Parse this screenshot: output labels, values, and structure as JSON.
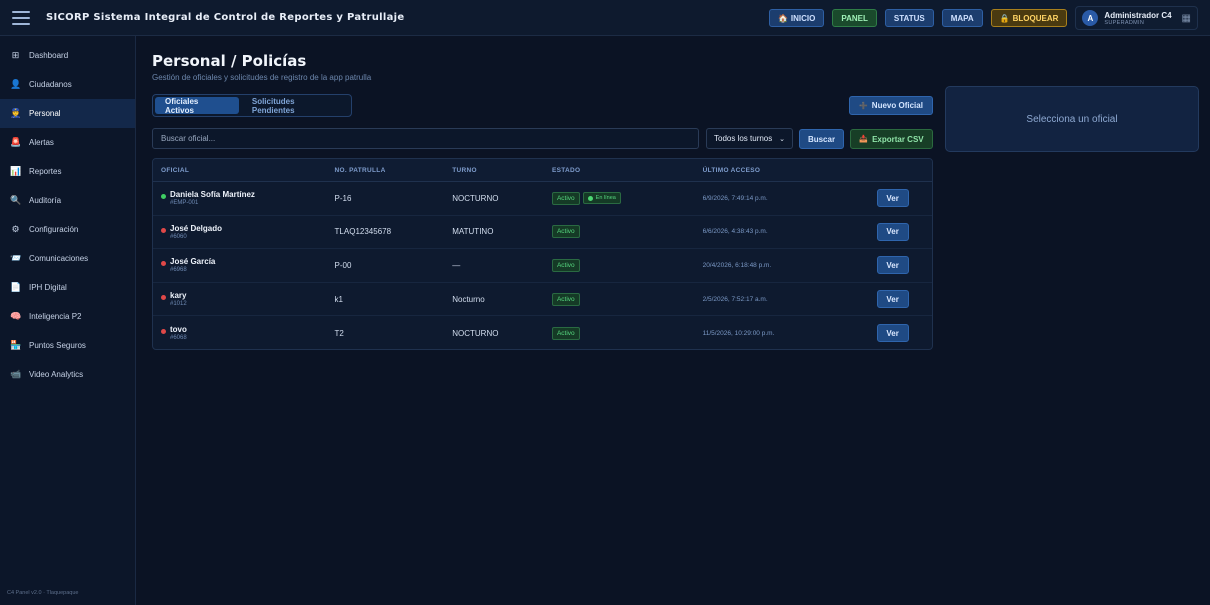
{
  "header": {
    "title": "SICORP Sistema Integral de Control de Reportes y Patrullaje",
    "buttons": [
      {
        "label": "INICIO",
        "icon": "🏠"
      },
      {
        "label": "PANEL"
      },
      {
        "label": "STATUS"
      },
      {
        "label": "MAPA"
      },
      {
        "label": "BLOQUEAR",
        "icon": "🔒"
      }
    ],
    "user": {
      "initial": "A",
      "name": "Administrador C4",
      "role": "SUPERADMIN"
    }
  },
  "sidebar": {
    "items": [
      {
        "label": "Dashboard",
        "icon": "⊞"
      },
      {
        "label": "Ciudadanos",
        "icon": "👤"
      },
      {
        "label": "Personal",
        "icon": "👮"
      },
      {
        "label": "Alertas",
        "icon": "🚨"
      },
      {
        "label": "Reportes",
        "icon": "📊"
      },
      {
        "label": "Auditoría",
        "icon": "🔍"
      },
      {
        "label": "Configuración",
        "icon": "⚙"
      },
      {
        "label": "Comunicaciones",
        "icon": "📨"
      },
      {
        "label": "IPH Digital",
        "icon": "📄"
      },
      {
        "label": "Inteligencia P2",
        "icon": "🧠"
      },
      {
        "label": "Puntos Seguros",
        "icon": "🏪"
      },
      {
        "label": "Video Analytics",
        "icon": "📹"
      }
    ],
    "active_index": 2,
    "footer": "C4 Panel v2.0 · Tlaquepaque"
  },
  "main": {
    "title": "Personal / Policías",
    "subtitle": "Gestión de oficiales y solicitudes de registro de la app patrulla",
    "tabs": [
      "Oficiales Activos",
      "Solicitudes Pendientes"
    ],
    "active_tab": 0,
    "new_button": {
      "label": "Nuevo Oficial",
      "icon": "➕"
    },
    "search_placeholder": "Buscar oficial...",
    "shift_filter": "Todos los turnos",
    "search_button": "Buscar",
    "export_button": {
      "label": "Exportar CSV",
      "icon": "📥"
    },
    "table": {
      "headers": [
        "OFICIAL",
        "NO. PATRULLA",
        "TURNO",
        "ESTADO",
        "ÚLTIMO ACCESO",
        ""
      ],
      "rows": [
        {
          "name": "Daniela Sofía Martínez",
          "id": "#EMP-001",
          "patrol": "P-16",
          "shift": "NOCTURNO",
          "status": "Activo",
          "online": "En línea",
          "last_access": "6/9/2026, 7:49:14 p.m.",
          "action": "Ver",
          "dot": "#3fce63"
        },
        {
          "name": "José Delgado",
          "id": "#6060",
          "patrol": "TLAQ12345678",
          "shift": "MATUTINO",
          "status": "Activo",
          "last_access": "6/6/2026, 4:38:43 p.m.",
          "action": "Ver",
          "dot": "#e04848"
        },
        {
          "name": "José García",
          "id": "#6968",
          "patrol": "P-00",
          "shift": "—",
          "status": "Activo",
          "last_access": "20/4/2026, 6:18:48 p.m.",
          "action": "Ver",
          "dot": "#e04848"
        },
        {
          "name": "kary",
          "id": "#1012",
          "patrol": "k1",
          "shift": "Nocturno",
          "status": "Activo",
          "last_access": "2/5/2026, 7:52:17 a.m.",
          "action": "Ver",
          "dot": "#e04848"
        },
        {
          "name": "tovo",
          "id": "#6068",
          "patrol": "T2",
          "shift": "NOCTURNO",
          "status": "Activo",
          "last_access": "11/5/2026, 10:29:00 p.m.",
          "action": "Ver",
          "dot": "#e04848"
        }
      ]
    },
    "detail_placeholder": "Selecciona un oficial"
  }
}
